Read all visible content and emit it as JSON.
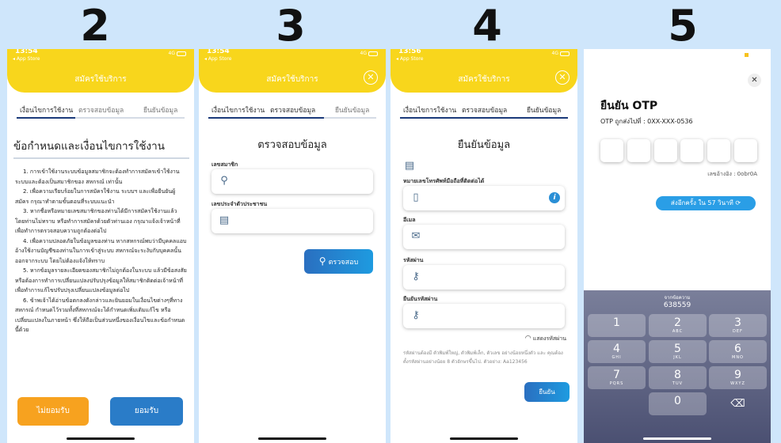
{
  "steps": [
    "2",
    "3",
    "4",
    "5"
  ],
  "status": {
    "times": [
      "13:54",
      "13:54",
      "13:56"
    ],
    "back": "◂ App Store",
    "network": "4G"
  },
  "header_title": "สมัครใช้บริการ",
  "tabs": [
    "เงื่อนไขการใช้งาน",
    "ตรวจสอบข้อมูล",
    "ยืนยันข้อมูล"
  ],
  "screen2": {
    "title": "ข้อกำหนดและเงื่อนไขการใช้งาน",
    "paragraphs": [
      "1. การเข้าใช้งานระบบข้อมูลสมาชิกจะต้องทำการสมัครเข้าใช้งานระบบและต้องเป็นสมาชิกของ สหกรณ์ เท่านั้น",
      "2. เพื่อความเรียบร้อยในการสมัครใช้งาน ระบบฯ และเพื่อยืนยันผู้สมัคร กรุณาทำตามขั้นตอนที่ระบบแนะนำ",
      "3. หากชื่อหรือหมายเลขสมาชิกของท่านได้มีการสมัครใช้งานแล้ว โดยท่านไม่ทราบ หรือทำการสมัครด้วยตัวท่านเอง กรุณาแจ้งเจ้าหน้าที่เพื่อทำการตรวจสอบความถูกต้องต่อไป",
      "4. เพื่อความปลอดภัยในข้อมูลของท่าน หากสหกรณ์พบว่ามีบุคคลแอบอ้างใช้งานบัญชีของท่านในการเข้าสู่ระบบ สหกรณ์จะระงับกับบุคคลนั้นออกจากระบบ โดยไม่ต้องแจ้งให้ทราบ",
      "5. หากข้อมูลรายละเอียดของสมาชิกไม่ถูกต้องในระบบ แล้วมีข้อสงสัยหรือต้องการทำการเปลี่ยนแปลงปรับปรุงข้อมูลให้สมาชิกติดต่อเจ้าหน้าที่เพื่อทำการแก้ไขปรับปรุงเปลี่ยนแปลงข้อมูลต่อไป",
      "6. ข้าพเจ้าได้อ่านข้อตกลงดังกล่าวและยินยอมในเงื่อนไขต่างๆที่ทางสหกรณ์ กำหนดไว้รวมทั้งที่สหกรณ์จะได้กำหนดเพิ่มเติมแก้ไข หรือเปลี่ยนแปลงในภายหน้า ซึ่งให้ถือเป็นส่วนหนึ่งของเงื่อนไขและข้อกำหนดนี้ด้วย"
    ],
    "decline": "ไม่ยอมรับ",
    "accept": "ยอมรับ"
  },
  "screen3": {
    "title": "ตรวจสอบข้อมูล",
    "member_label": "เลขสมาชิก",
    "id_label": "เลขประจำตัวประชาชน",
    "check_button": "ตรวจสอบ"
  },
  "screen4": {
    "title": "ยืนยันข้อมูล",
    "phone_label": "หมายเลขโทรศัพท์มือถือที่ติดต่อได้",
    "email_label": "อีเมล",
    "password_label": "รหัสผ่าน",
    "confirm_label": "ยืนยันรหัสผ่าน",
    "show_password": "แสดงรหัสผ่าน",
    "note": "รหัสผ่านต้องมี ตัวพิมพ์ใหญ่, ตัวพิมพ์เล็ก, ตัวเลข อย่างน้อยหนึ่งตัว และ คุณต้องตั้งรหัสผ่านอย่างน้อย 8 ตัวอักษรขึ้นไป. ตัวอย่าง: Aa123456",
    "confirm_button": "ยืนยัน"
  },
  "screen5": {
    "title": "ยืนยัน OTP",
    "sent_to": "OTP ถูกส่งไปที่ : 0XX-XXX-0536",
    "ref": "เลขอ้างอิง : 0obr0A",
    "resend": "ส่งอีกครั้ง ใน 57 วินาที",
    "suggest_label": "จากข้อความ",
    "suggest_code": "638559",
    "keys": [
      {
        "d": "1",
        "l": ""
      },
      {
        "d": "2",
        "l": "ABC"
      },
      {
        "d": "3",
        "l": "DEF"
      },
      {
        "d": "4",
        "l": "GHI"
      },
      {
        "d": "5",
        "l": "JKL"
      },
      {
        "d": "6",
        "l": "MNO"
      },
      {
        "d": "7",
        "l": "PQRS"
      },
      {
        "d": "8",
        "l": "TUV"
      },
      {
        "d": "9",
        "l": "WXYZ"
      },
      {
        "d": "0",
        "l": ""
      }
    ]
  },
  "colors": {
    "header": "#f8d61c",
    "orange": "#f7a21f",
    "blue": "#1e6fbf",
    "resend": "#2a9ee6"
  }
}
